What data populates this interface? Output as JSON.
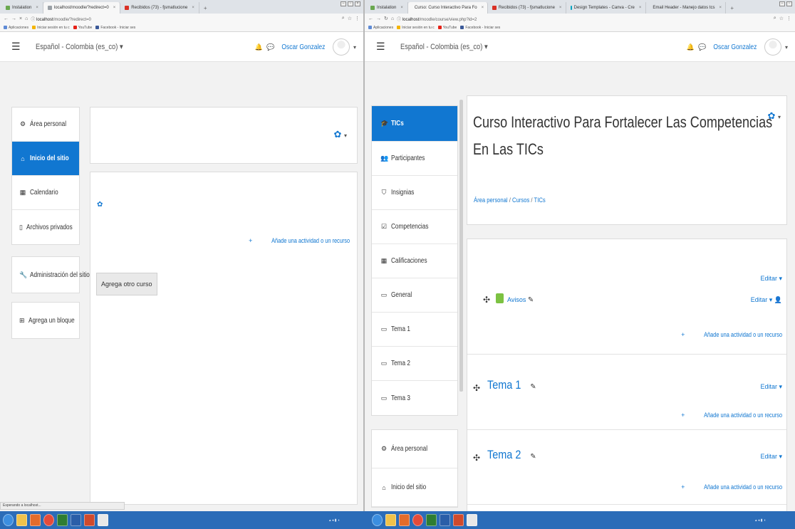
{
  "left_window": {
    "tabs": [
      {
        "label": "Instalation",
        "active": false,
        "color": "#6aa84f"
      },
      {
        "label": "localhost/moodle/?redirect=0",
        "active": true,
        "color": "#9aa0a6"
      },
      {
        "label": "Recibidos (73) - fjsmatlucione",
        "active": false,
        "color": "#d93025"
      }
    ],
    "new_tab": "+",
    "url_host": "localhost",
    "url_path": "/moodle/?redirect=0",
    "bookmarks": [
      "Aplicaciones",
      "Iniciar sesión en tu c",
      "YouTube",
      "Facebook - Iniciar ses"
    ],
    "language": "Español - Colombia (es_co)",
    "username": "Oscar Gonzalez",
    "nav": [
      {
        "icon": "dashboard-icon",
        "glyph": "⚙",
        "label": "Área personal",
        "active": false
      },
      {
        "icon": "home-icon",
        "glyph": "⌂",
        "label": "Inicio del sitio",
        "active": true
      },
      {
        "icon": "calendar-icon",
        "glyph": "▦",
        "label": "Calendario",
        "active": false
      },
      {
        "icon": "file-icon",
        "glyph": "▯",
        "label": "Archivos privados",
        "active": false
      }
    ],
    "admin": {
      "label": "Administración del sitio"
    },
    "add_block": {
      "label": "Agrega un bloque"
    },
    "add_activity": "Añade una actividad o un recurso",
    "add_course": "Agrega otro curso",
    "status": "Esperando a localhost..."
  },
  "right_window": {
    "tabs": [
      {
        "label": "Instalation",
        "active": false,
        "color": "#6aa84f"
      },
      {
        "label": "Curso: Curso Interactivo Para Fo",
        "active": true,
        "color": "#e6a23c"
      },
      {
        "label": "Recibidos (73) - fjsmatlucione",
        "active": false,
        "color": "#d93025"
      },
      {
        "label": "Design Templates - Canva - Cre",
        "active": false,
        "color": "#00a3bf"
      },
      {
        "label": "Email Header - Manejo datos tcs",
        "active": false,
        "color": "#00a3bf"
      }
    ],
    "new_tab": "+",
    "url_host": "localhost",
    "url_path": "/moodle/course/view.php?id=2",
    "bookmarks": [
      "Aplicaciones",
      "Iniciar sesión en tu c",
      "YouTube",
      "Facebook - Iniciar ses"
    ],
    "language": "Español - Colombia (es_co)",
    "username": "Oscar Gonzalez",
    "nav": [
      {
        "icon": "graduation-cap-icon",
        "glyph": "🎓",
        "label": "TICs",
        "active": true
      },
      {
        "icon": "users-icon",
        "glyph": "👥",
        "label": "Participantes",
        "active": false
      },
      {
        "icon": "shield-icon",
        "glyph": "⛉",
        "label": "Insignias",
        "active": false
      },
      {
        "icon": "checkbox-icon",
        "glyph": "☑",
        "label": "Competencias",
        "active": false
      },
      {
        "icon": "table-icon",
        "glyph": "▦",
        "label": "Calificaciones",
        "active": false
      },
      {
        "icon": "folder-icon",
        "glyph": "▭",
        "label": "General",
        "active": false
      },
      {
        "icon": "folder-icon",
        "glyph": "▭",
        "label": "Tema 1",
        "active": false
      },
      {
        "icon": "folder-icon",
        "glyph": "▭",
        "label": "Tema 2",
        "active": false
      },
      {
        "icon": "folder-icon",
        "glyph": "▭",
        "label": "Tema 3",
        "active": false
      }
    ],
    "nav2": [
      {
        "icon": "dashboard-icon",
        "glyph": "⚙",
        "label": "Área personal"
      },
      {
        "icon": "home-icon",
        "glyph": "⌂",
        "label": "Inicio del sitio"
      }
    ],
    "course_title": "Curso Interactivo Para Fortalecer Las Competencias En Las TICs",
    "breadcrumb": [
      "Área personal",
      "Cursos",
      "TICs"
    ],
    "general_section": {
      "edit": "Editar",
      "activity": "Avisos",
      "activity_edit": "Editar",
      "add_activity": "Añade una actividad o un recurso"
    },
    "sections": [
      {
        "title": "Tema 1",
        "edit": "Editar",
        "add_activity": "Añade una actividad o un recurso"
      },
      {
        "title": "Tema 2",
        "edit": "Editar",
        "add_activity": "Añade una actividad o un recurso"
      }
    ]
  },
  "colors": {
    "accent": "#1177d1",
    "taskbar": "#2b6cb8"
  }
}
